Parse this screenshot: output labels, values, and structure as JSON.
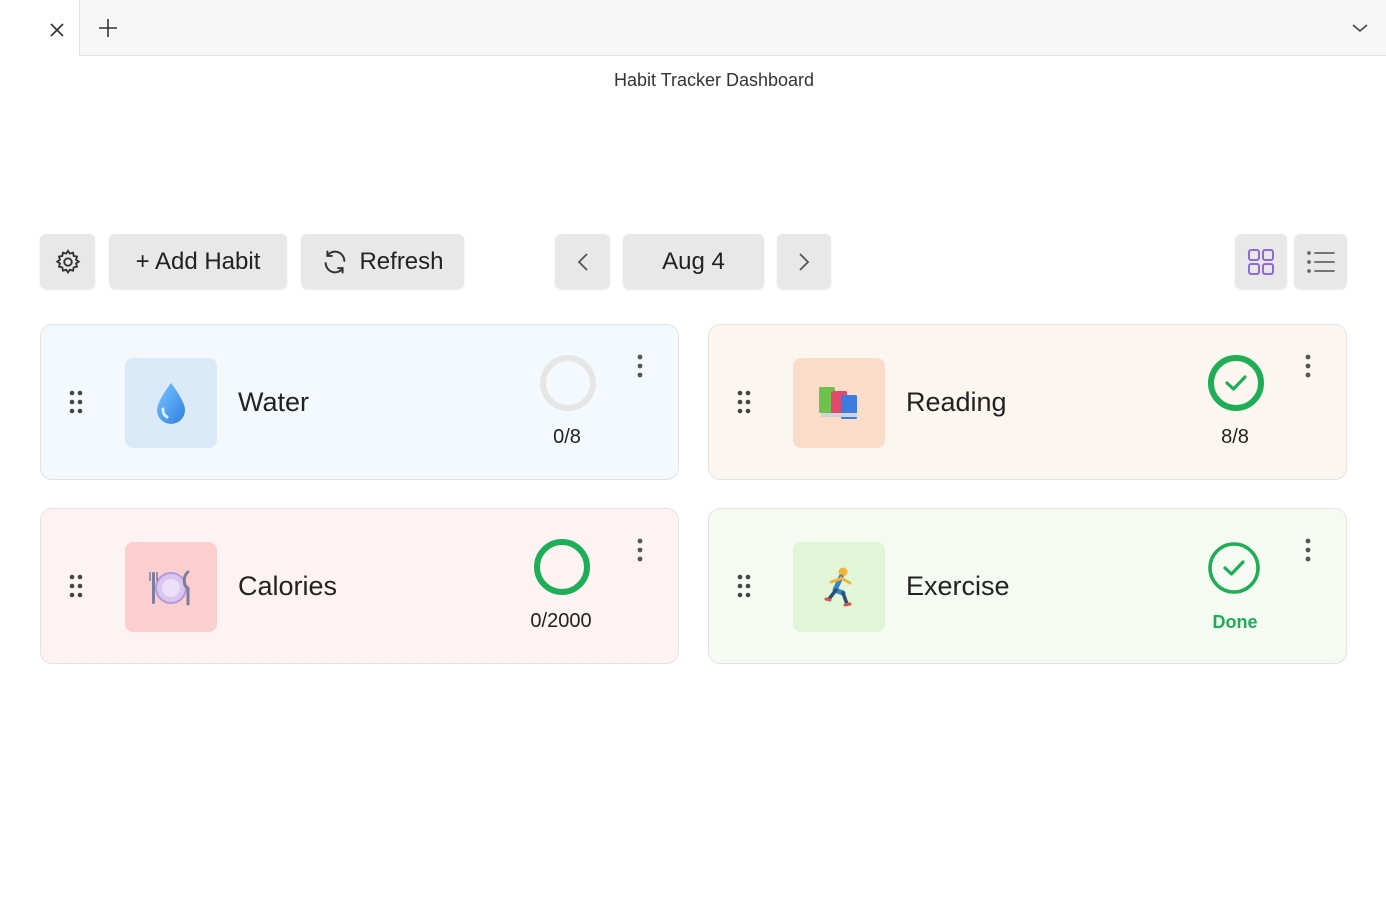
{
  "window": {
    "title": "Habit Tracker Dashboard"
  },
  "icons": {
    "tab_close": "close-icon",
    "tab_new": "plus-icon",
    "tab_menu": "chevron-down-icon",
    "settings": "gear-icon",
    "refresh": "refresh-icon",
    "prev": "chevron-left-icon",
    "next": "chevron-right-icon",
    "grid": "grid-view-icon",
    "list": "list-view-icon"
  },
  "toolbar": {
    "add_label": "+ Add Habit",
    "refresh_label": "Refresh",
    "date_label": "Aug 4"
  },
  "colors": {
    "done_green": "#1fae57",
    "ring_empty": "#e6e6e6",
    "view_accent": "#8e6ad8"
  },
  "habits": [
    {
      "name": "Water",
      "emoji": "💧",
      "progress": "0/8",
      "complete": false
    },
    {
      "name": "Reading",
      "emoji": "📚",
      "progress": "8/8",
      "complete": true
    },
    {
      "name": "Calories",
      "emoji": "🍽️",
      "progress": "0/2000",
      "complete": false
    },
    {
      "name": "Exercise",
      "emoji": "🏃",
      "progress": "Done",
      "complete": true
    }
  ]
}
